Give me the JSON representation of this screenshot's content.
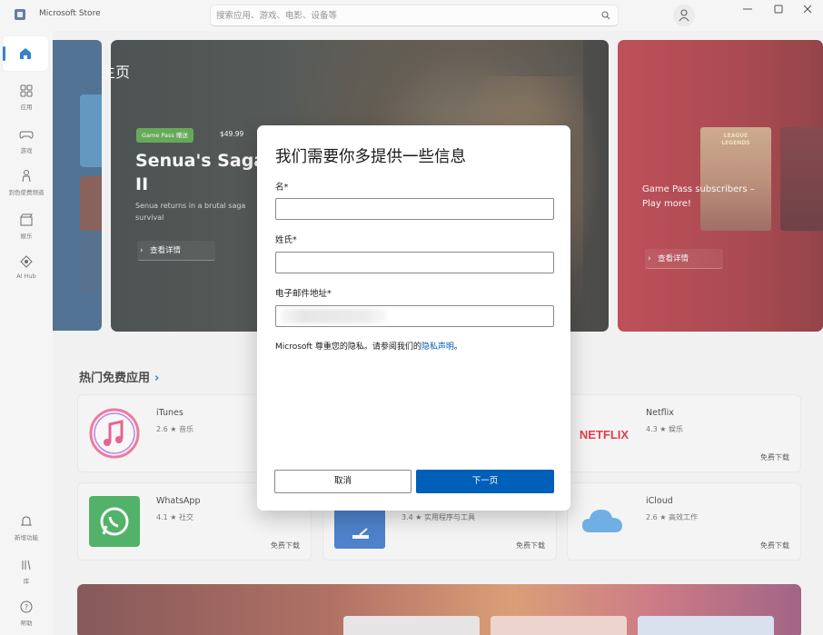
{
  "window": {
    "title": "Microsoft Store",
    "search_placeholder": "搜索应用、游戏、电影、设备等"
  },
  "sidebar": {
    "items": [
      {
        "label": "",
        "icon": "home-icon"
      },
      {
        "label": "应用",
        "icon": "apps-icon"
      },
      {
        "label": "游戏",
        "icon": "gamepad-icon"
      },
      {
        "label": "到色使费频道",
        "icon": "figure-icon"
      },
      {
        "label": "娱乐",
        "icon": "film-icon"
      },
      {
        "label": "AI Hub",
        "icon": "ai-hub-icon"
      }
    ],
    "bottom": [
      {
        "label": "新增功能",
        "icon": "bell-icon"
      },
      {
        "label": "库",
        "icon": "library-icon"
      },
      {
        "label": "帮助",
        "icon": "help-icon"
      }
    ]
  },
  "main": {
    "page_title": "主页",
    "hero": {
      "badge": "Game Pass 赠送",
      "price": "$49.99",
      "title_line1": "Senua's Saga:",
      "title_line2": "II",
      "desc_line1": "Senua returns in a brutal saga",
      "desc_line2": "survival",
      "button": "查看详情"
    },
    "hero_right": {
      "card_logo": "LEAGUE LEGENDS",
      "subtitle_line1": "Game Pass subscribers –",
      "subtitle_line2": "Play more!",
      "button": "查看详情"
    },
    "section_title": "热门免费应用",
    "apps": [
      {
        "name": "iTunes",
        "rating": "2.6",
        "category": "音乐",
        "action": ""
      },
      {
        "name": "Netflix",
        "rating": "4.3",
        "category": "娱乐",
        "action": "免费下载"
      },
      {
        "name": "WhatsApp",
        "rating": "4.1",
        "category": "社交",
        "action": "免费下载"
      },
      {
        "name": "",
        "rating": "3.4",
        "category": "实用程序与工具",
        "action": "免费下载"
      },
      {
        "name": "iCloud",
        "rating": "2.6",
        "category": "高效工作",
        "action": "免费下载"
      }
    ]
  },
  "dialog": {
    "title": "我们需要你多提供一些信息",
    "first_name_label": "名*",
    "last_name_label": "姓氏*",
    "email_label": "电子邮件地址*",
    "first_name_value": "",
    "last_name_value": "",
    "privacy_text": "Microsoft 尊重您的隐私。请参阅我们的",
    "privacy_link": "隐私声明",
    "privacy_end": "。",
    "cancel": "取消",
    "next": "下一页"
  },
  "colors": {
    "accent": "#005fb8",
    "gamepass_green": "#3f9a2d",
    "netflix_red": "#e50914"
  }
}
